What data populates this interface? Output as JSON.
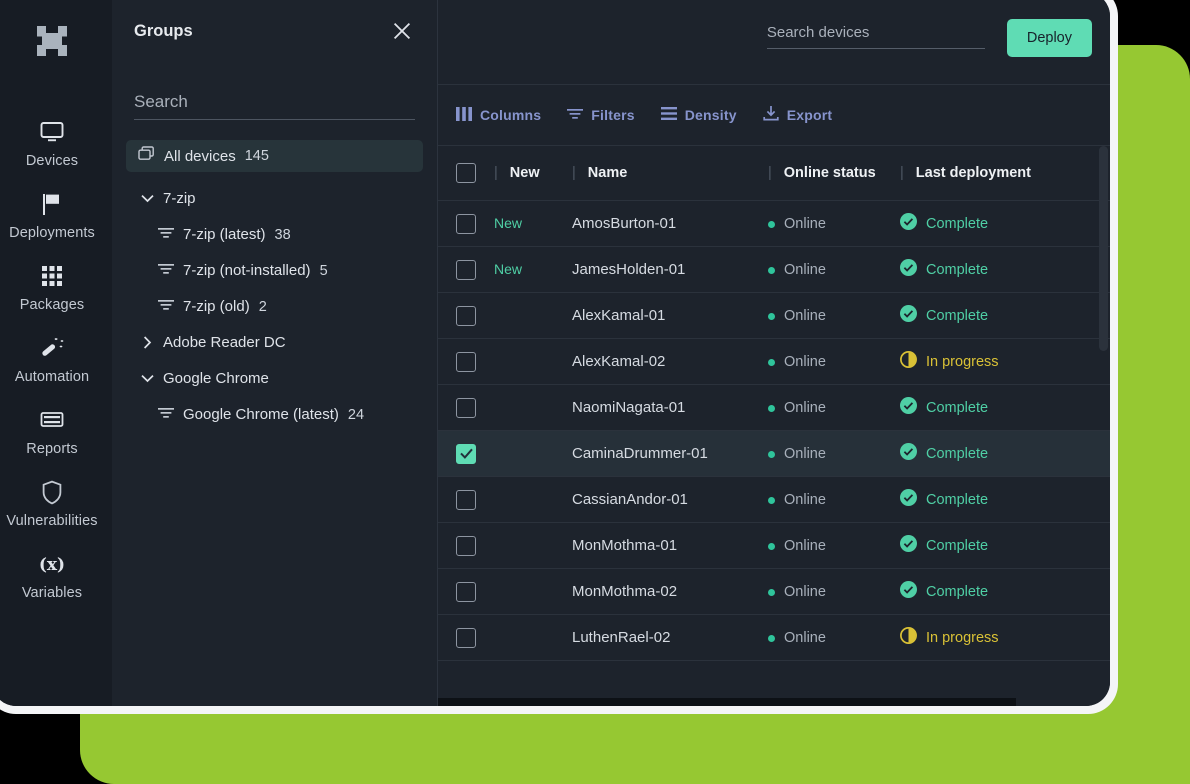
{
  "theme": {
    "accent_teal": "#5fdcb4",
    "accent_blue": "#8794cd",
    "status_complete": "#4fcfa5",
    "status_inprogress": "#d9c136",
    "background_lime": "#96c832",
    "window_bg": "#1d232c",
    "sidebar_bg": "#171c24"
  },
  "sidebar": {
    "logo_icon": "app-logo-icon",
    "items": [
      {
        "label": "Devices",
        "icon": "monitor-icon"
      },
      {
        "label": "Deployments",
        "icon": "flag-icon"
      },
      {
        "label": "Packages",
        "icon": "grid-dots-icon"
      },
      {
        "label": "Automation",
        "icon": "magic-wand-icon"
      },
      {
        "label": "Reports",
        "icon": "report-lines-icon"
      },
      {
        "label": "Vulnerabilities",
        "icon": "shield-icon"
      },
      {
        "label": "Variables",
        "icon": "variable-x-icon"
      }
    ]
  },
  "groups_panel": {
    "title": "Groups",
    "close_icon": "close-icon",
    "search": {
      "placeholder": "Search",
      "value": ""
    },
    "tree": [
      {
        "label": "All devices",
        "count": "145",
        "level": 0,
        "icon": "devices-stack-icon",
        "selected": true
      },
      {
        "label": "7-zip",
        "count": "",
        "level": 1,
        "icon": "chevron-down-icon",
        "expanded": true
      },
      {
        "label": "7-zip (latest)",
        "count": "38",
        "level": 2,
        "icon": "filter-icon"
      },
      {
        "label": "7-zip (not-installed)",
        "count": "5",
        "level": 2,
        "icon": "filter-icon"
      },
      {
        "label": "7-zip (old)",
        "count": "2",
        "level": 2,
        "icon": "filter-icon"
      },
      {
        "label": "Adobe Reader DC",
        "count": "",
        "level": 1,
        "icon": "chevron-right-icon",
        "expanded": false
      },
      {
        "label": "Google Chrome",
        "count": "",
        "level": 1,
        "icon": "chevron-down-icon",
        "expanded": true
      },
      {
        "label": "Google Chrome (latest)",
        "count": "24",
        "level": 2,
        "icon": "filter-icon"
      }
    ]
  },
  "top_bar": {
    "search": {
      "placeholder": "Search devices",
      "value": ""
    },
    "deploy_label": "Deploy"
  },
  "toolbar": {
    "buttons": [
      {
        "label": "Columns",
        "icon": "columns-icon"
      },
      {
        "label": "Filters",
        "icon": "filter-icon"
      },
      {
        "label": "Density",
        "icon": "density-icon"
      },
      {
        "label": "Export",
        "icon": "export-download-icon"
      }
    ]
  },
  "table": {
    "columns": [
      "New",
      "Name",
      "Online status",
      "Last deployment"
    ],
    "rows": [
      {
        "new": "New",
        "name": "AmosBurton-01",
        "online": "Online",
        "deployment": "Complete",
        "status": "complete",
        "selected": false
      },
      {
        "new": "New",
        "name": "JamesHolden-01",
        "online": "Online",
        "deployment": "Complete",
        "status": "complete",
        "selected": false
      },
      {
        "new": "",
        "name": "AlexKamal-01",
        "online": "Online",
        "deployment": "Complete",
        "status": "complete",
        "selected": false
      },
      {
        "new": "",
        "name": "AlexKamal-02",
        "online": "Online",
        "deployment": "In progress",
        "status": "inprogress",
        "selected": false
      },
      {
        "new": "",
        "name": "NaomiNagata-01",
        "online": "Online",
        "deployment": "Complete",
        "status": "complete",
        "selected": false
      },
      {
        "new": "",
        "name": "CaminaDrummer-01",
        "online": "Online",
        "deployment": "Complete",
        "status": "complete",
        "selected": true
      },
      {
        "new": "",
        "name": "CassianAndor-01",
        "online": "Online",
        "deployment": "Complete",
        "status": "complete",
        "selected": false
      },
      {
        "new": "",
        "name": "MonMothma-01",
        "online": "Online",
        "deployment": "Complete",
        "status": "complete",
        "selected": false
      },
      {
        "new": "",
        "name": "MonMothma-02",
        "online": "Online",
        "deployment": "Complete",
        "status": "complete",
        "selected": false
      },
      {
        "new": "",
        "name": "LuthenRael-02",
        "online": "Online",
        "deployment": "In progress",
        "status": "inprogress",
        "selected": false
      }
    ]
  }
}
